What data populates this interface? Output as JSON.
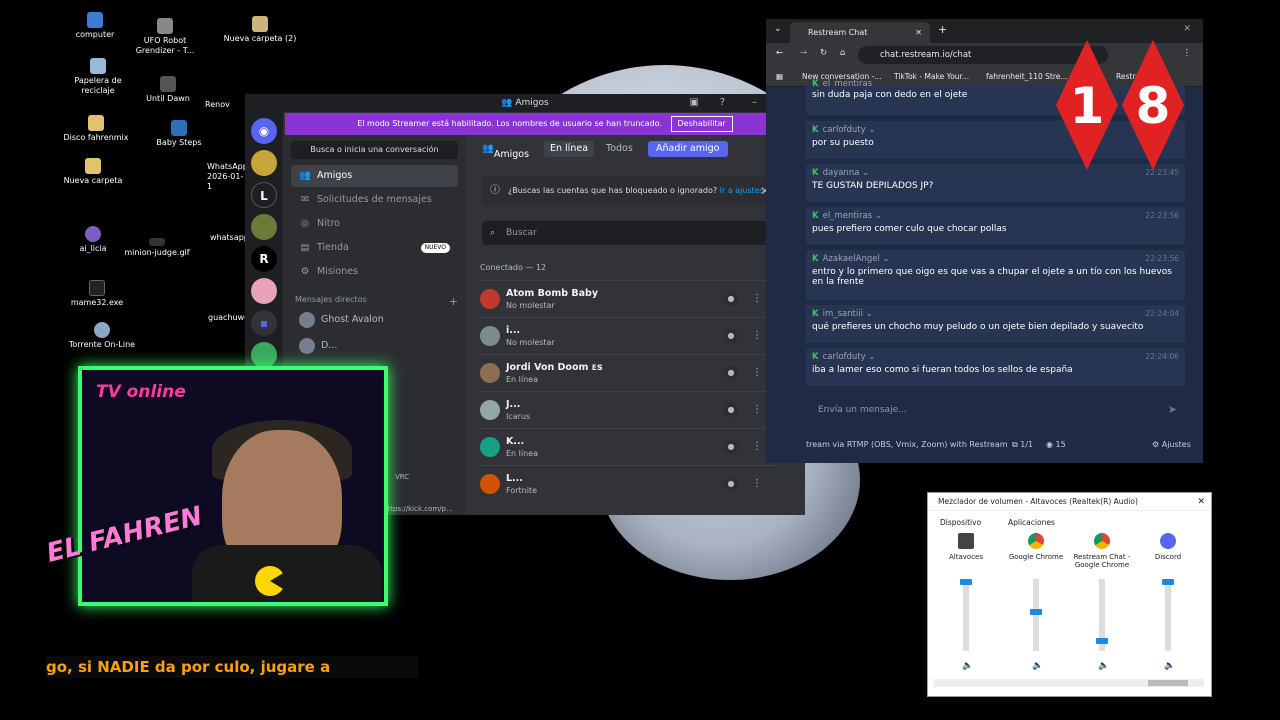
{
  "desktop": {
    "icons": [
      {
        "label": "computer"
      },
      {
        "label": "UFO Robot Grendizer - T..."
      },
      {
        "label": "Nueva carpeta (2)"
      },
      {
        "label": "Papelera de reciclaje"
      },
      {
        "label": "Until Dawn"
      },
      {
        "label": "Disco fahrenmix"
      },
      {
        "label": "Baby Steps"
      },
      {
        "label": "Nueva carpeta"
      },
      {
        "label": "ai_licia"
      },
      {
        "label": "minion-judge.gif"
      },
      {
        "label": "mame32.exe"
      },
      {
        "label": "Torrente On-Line"
      },
      {
        "label": "Renov"
      },
      {
        "label": "WhatsApp 2026-01-1"
      },
      {
        "label": "whatsapp"
      },
      {
        "label": "guachuwe"
      }
    ]
  },
  "discord": {
    "window_title": "Amigos",
    "banner": {
      "text": "El modo Streamer está habilitado. Los nombres de usuario se han truncado.",
      "button": "Deshabilitar"
    },
    "search_placeholder": "Busca o inicia una conversación",
    "nav": [
      {
        "label": "Amigos"
      },
      {
        "label": "Solicitudes de mensajes"
      },
      {
        "label": "Nitro"
      },
      {
        "label": "Tienda",
        "badge": "NUEVO"
      },
      {
        "label": "Misiones"
      }
    ],
    "dm_header": "Mensajes directos",
    "dms": [
      {
        "name": "Ghost Avalon"
      },
      {
        "name": "D..."
      }
    ],
    "tabs": {
      "title": "Amigos",
      "online": "En línea",
      "all": "Todos",
      "add": "Añadir amigo"
    },
    "info": {
      "text": "¿Buscas las cuentas que has bloqueado o ignorado?",
      "link": "Ir a ajustes"
    },
    "find_placeholder": "Buscar",
    "count_label": "Conectado — 12",
    "friends": [
      {
        "name": "Atom Bomb Baby",
        "status": "No molestar",
        "color": "#c0392b"
      },
      {
        "name": "i...",
        "status": "No molestar",
        "color": "#7f8c8d"
      },
      {
        "name": "Jordi Von Doom ᴇꜱ",
        "status": "En línea",
        "color": "#8e6e53"
      },
      {
        "name": "J...",
        "status": "Icarus",
        "color": "#95a5a6"
      },
      {
        "name": "K...",
        "status": "En línea",
        "color": "#16a085"
      },
      {
        "name": "L...",
        "status": "Fortnite",
        "color": "#d35400"
      }
    ],
    "status_vrc": "VRC",
    "kick_url": "https://kick.com/p..."
  },
  "chrome": {
    "tab_title": "Restream Chat",
    "url": "chat.restream.io/chat",
    "bookmarks": [
      "New conversation -...",
      "TikTok - Make Your...",
      "fahrenheit_110 Stre...",
      "Restream Ch..."
    ],
    "messages": [
      {
        "user": "el_mentiras",
        "time": "",
        "text": "sin duda paja con dedo en el ojete"
      },
      {
        "user": "carlofduty",
        "time": "",
        "text": "por su puesto"
      },
      {
        "user": "dayanna",
        "time": "22:23:45",
        "text": "TE GUSTAN DEPILADOS JP?"
      },
      {
        "user": "el_mentiras",
        "time": "22:23:56",
        "text": "pues prefiero comer culo que chocar pollas"
      },
      {
        "user": "AzakaelAngel",
        "time": "22:23:56",
        "text": "entro y lo primero que oigo es que vas a chupar el ojete a un tío con los huevos en la frente"
      },
      {
        "user": "im_santiii",
        "time": "22:24:04",
        "text": "qué prefieres un chocho muy peludo o un ojete bien depilado y suavecito"
      },
      {
        "user": "carlofduty",
        "time": "22:24:06",
        "text": "iba a lamer eso como si fueran todos los sellos de españa"
      }
    ],
    "input_placeholder": "Envía un mensaje...",
    "footer_text": "tream via RTMP (OBS, Vmix, Zoom) with Restream",
    "footer_count": "1/1",
    "viewers": "15",
    "settings": "Ajustes"
  },
  "badge18": [
    "1",
    "8"
  ],
  "mixer": {
    "title": "Mezclador de volumen - Altavoces (Realtek(R) Audio)",
    "device_header": "Dispositivo",
    "apps_header": "Aplicaciones",
    "channels": [
      {
        "label": "Altavoces",
        "level": 1.0
      },
      {
        "label": "Google Chrome",
        "level": 0.55
      },
      {
        "label": "Restream Chat - Google Chrome",
        "level": 0.1
      },
      {
        "label": "Discord",
        "level": 1.0
      }
    ]
  },
  "overlay": {
    "tv_label": "TV online",
    "brand": "EL FAHREN",
    "ticker": "go, si NADIE da por culo, jugare a"
  },
  "colors": {
    "discord_bg": "#313338",
    "streamer_banner": "#8c33d6",
    "discord_accent": "#5865f2",
    "restream_green": "#3fbf6a",
    "badge_red": "#e02222",
    "overlay_green": "#3aff6a"
  }
}
